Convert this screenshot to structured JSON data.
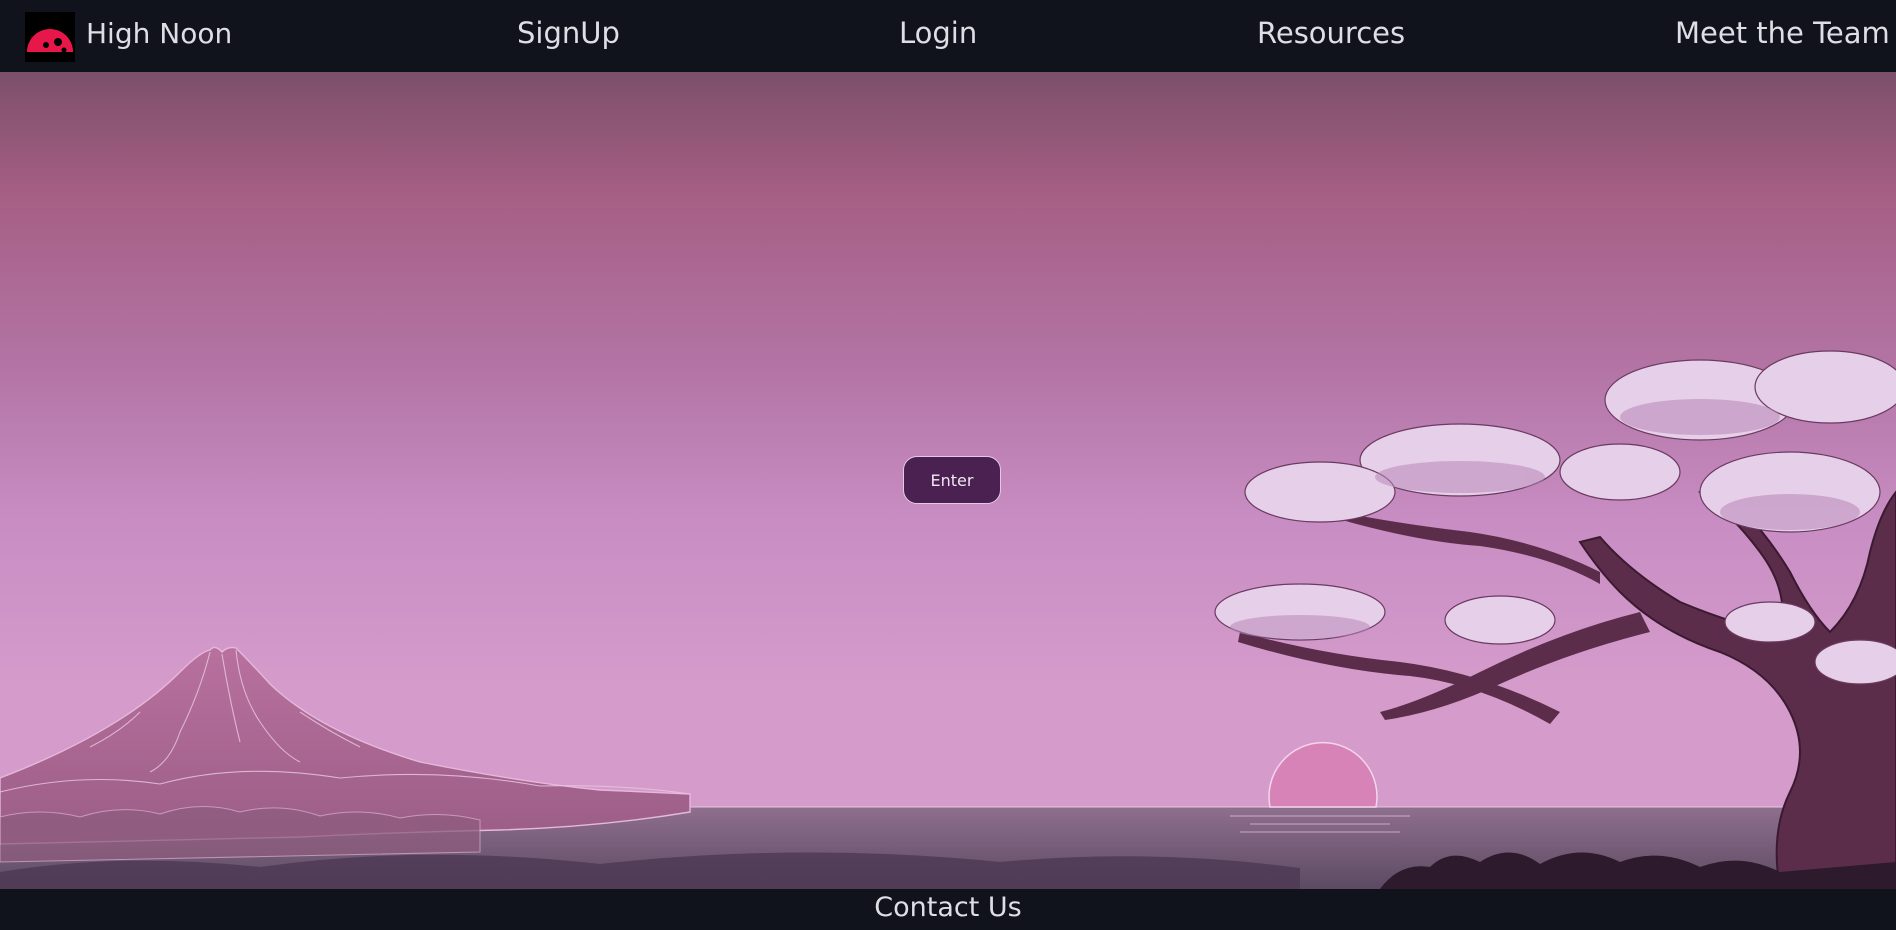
{
  "nav": {
    "brand": "High Noon",
    "logo_icon": "red-sun-logo-icon",
    "links": [
      "SignUp",
      "Login",
      "Resources",
      "Meet the Team"
    ]
  },
  "hero": {
    "enter_label": "Enter"
  },
  "footer": {
    "contact_label": "Contact Us"
  },
  "colors": {
    "nav_bg": "#10131b",
    "sky_top": "#7c4f6a",
    "sky_mid": "#c289bd",
    "button_bg": "#4a2150",
    "logo_red": "#e8174a"
  }
}
